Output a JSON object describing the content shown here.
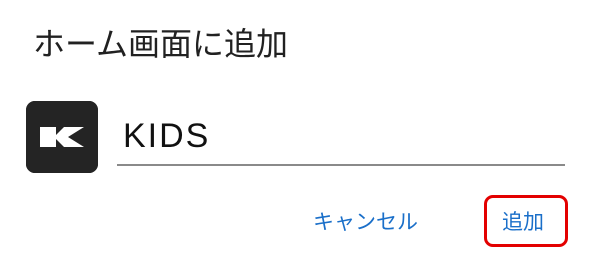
{
  "dialog": {
    "title": "ホーム画面に追加",
    "app": {
      "icon": "kids-app-logo-icon",
      "name_value": "KIDS"
    },
    "buttons": {
      "cancel_label": "キャンセル",
      "add_label": "追加"
    }
  },
  "colors": {
    "accent": "#1a6fc9",
    "highlight_outline": "#e30000",
    "icon_background": "#242424"
  }
}
